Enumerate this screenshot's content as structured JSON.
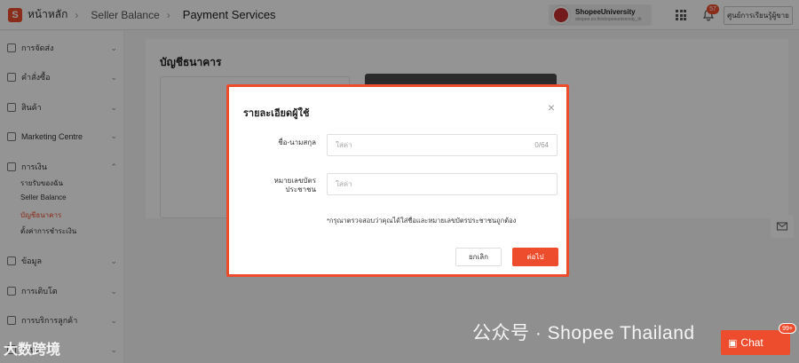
{
  "header": {
    "logo_letter": "S",
    "home_label": "หน้าหลัก",
    "crumb_1": "Seller Balance",
    "crumb_2": "Payment Services",
    "separator": "›",
    "shop_name": "ShopeeUniversity",
    "shop_sub": "shopee.co.th/shopeeuniversity_th",
    "notification_count": "57",
    "learn_button": "ศูนย์การเรียนรู้ผู้ขาย"
  },
  "sidebar": {
    "items": [
      {
        "label": "การจัดส่ง",
        "icon": "truck-icon",
        "chevron": "⌄"
      },
      {
        "label": "คำสั่งซื้อ",
        "icon": "clipboard-icon",
        "chevron": "⌄"
      },
      {
        "label": "สินค้า",
        "icon": "box-icon",
        "chevron": "⌄"
      },
      {
        "label": "Marketing Centre",
        "icon": "tag-icon",
        "chevron": "⌄"
      },
      {
        "label": "การเงิน",
        "icon": "wallet-icon",
        "chevron": "⌃"
      },
      {
        "label": "ข้อมูล",
        "icon": "chart-icon",
        "chevron": "⌄"
      },
      {
        "label": "การเติบโต",
        "icon": "growth-icon",
        "chevron": "⌄"
      },
      {
        "label": "การบริการลูกค้า",
        "icon": "service-icon",
        "chevron": "⌄"
      },
      {
        "label": "ร้านค้า",
        "icon": "shop-icon",
        "chevron": "⌄"
      }
    ],
    "finance_sub": [
      {
        "label": "รายรับของฉัน"
      },
      {
        "label": "Seller Balance"
      },
      {
        "label": "บัญชีธนาคาร"
      },
      {
        "label": "ตั้งค่าการชำระเงิน"
      }
    ]
  },
  "main": {
    "title": "บัญชีธนาคาร"
  },
  "modal": {
    "title": "รายละเอียดผู้ใช้",
    "name_label": "ชื่อ-นามสกุล",
    "name_placeholder": "ใส่ค่า",
    "name_counter": "0/64",
    "id_label_line1": "หมายเลขบัตร",
    "id_label_line2": "ประชาชน",
    "id_placeholder": "ใส่ค่า",
    "note": "*กรุณาตรวจสอบว่าคุณได้ใส่ชื่อและหมายเลขบัตรประชาชนถูกต้อง",
    "cancel_label": "ยกเลิก",
    "next_label": "ต่อไป",
    "close_glyph": "×"
  },
  "chat": {
    "label": "Chat",
    "badge": "99+"
  },
  "watermarks": {
    "left": "大数跨境",
    "right": "公众号 · Shopee Thailand"
  },
  "colors": {
    "brand": "#ee4d2d",
    "overlay": "rgba(0,0,0,0.42)"
  }
}
